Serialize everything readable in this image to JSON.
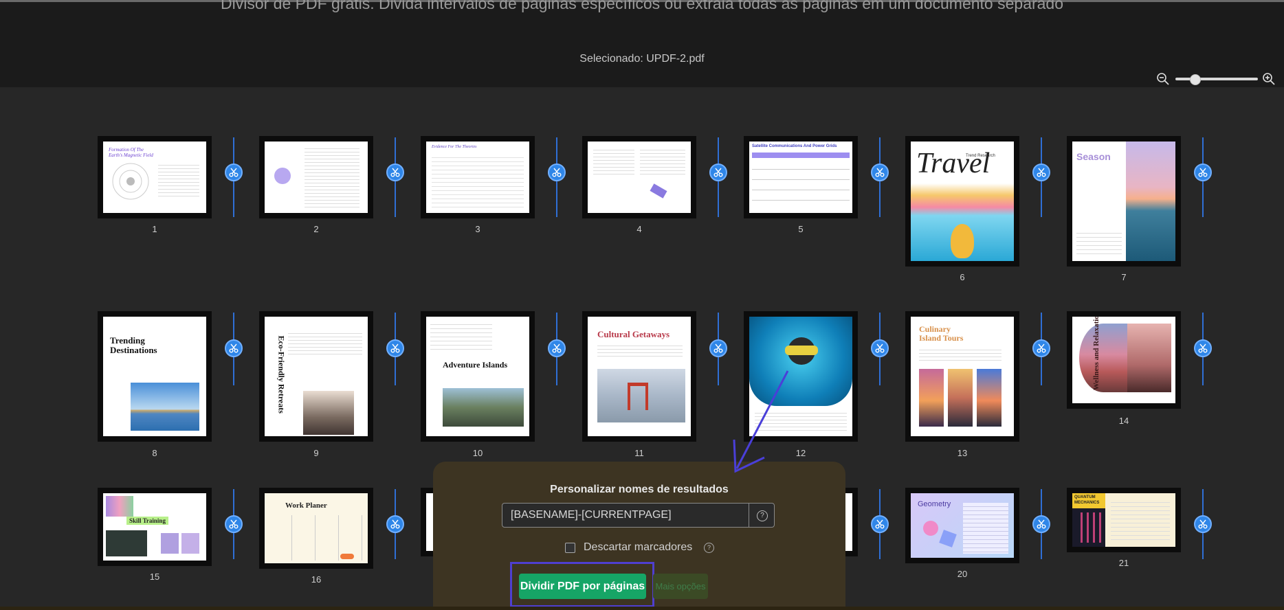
{
  "header": {
    "description": "Divisor de PDF grátis. Divida intervalos de páginas específicos ou extraia todas as páginas em um documento separado",
    "selected": "Selecionado: UPDF-2.pdf"
  },
  "zoom": {
    "level": 0.2
  },
  "pages": [
    {
      "num": "1",
      "title": "Formation Of The Earth's Magnetic Field"
    },
    {
      "num": "2",
      "title": ""
    },
    {
      "num": "3",
      "title": "Evidence For The Theories"
    },
    {
      "num": "4",
      "title": ""
    },
    {
      "num": "5",
      "title": "Satellite Communications And Power Grids"
    },
    {
      "num": "6",
      "title": "Travel",
      "subtitle": "Trend Research"
    },
    {
      "num": "7",
      "title": "Season"
    },
    {
      "num": "8",
      "title": "Trending Destinations"
    },
    {
      "num": "9",
      "title": "Eco-Friendly Retreats"
    },
    {
      "num": "10",
      "title": "Adventure Islands"
    },
    {
      "num": "11",
      "title": "Cultural Getaways"
    },
    {
      "num": "12",
      "title": ""
    },
    {
      "num": "13",
      "title": "Culinary Island Tours"
    },
    {
      "num": "14",
      "title": "Wellness and Relaxation"
    },
    {
      "num": "15",
      "title": "Skill Training"
    },
    {
      "num": "16",
      "title": "Work Planer"
    },
    {
      "num": "20",
      "title": "Geometry"
    },
    {
      "num": "21",
      "title": "QUANTUM MECHANICS"
    }
  ],
  "dialog": {
    "title": "Personalizar nomes de resultados",
    "name_pattern": "[BASENAME]-[CURRENTPAGE]",
    "discard_bookmarks_label": "Descartar marcadores",
    "split_button": "Dividir PDF por páginas",
    "more_options": "Mais opções"
  },
  "colors": {
    "accent": "#2f86e8",
    "button": "#16a566",
    "highlight": "#4f3fd0"
  }
}
